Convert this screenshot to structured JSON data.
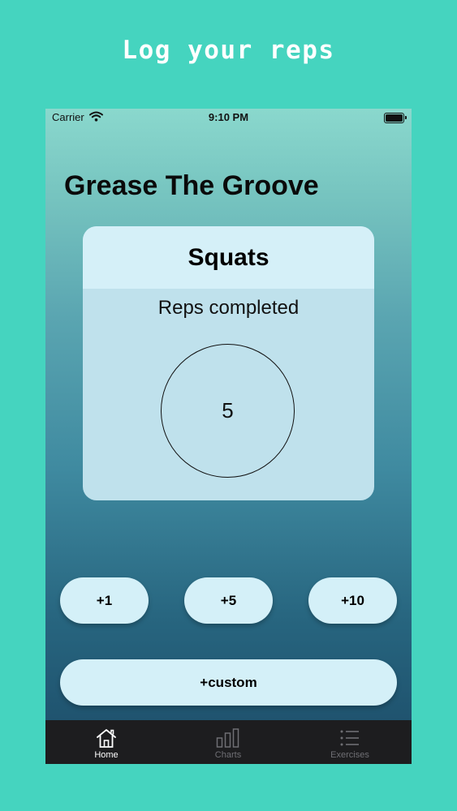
{
  "headline": "Log your reps",
  "status_bar": {
    "carrier": "Carrier",
    "time": "9:10 PM"
  },
  "app": {
    "title": "Grease The Groove"
  },
  "exercise_card": {
    "exercise_name": "Squats",
    "reps_label": "Reps completed",
    "reps_count": "5"
  },
  "buttons": {
    "plus_one": "+1",
    "plus_five": "+5",
    "plus_ten": "+10",
    "plus_custom": "+custom"
  },
  "tab_bar": {
    "items": [
      {
        "label": "Home",
        "icon": "home-icon",
        "active": true
      },
      {
        "label": "Charts",
        "icon": "bar-chart-icon",
        "active": false
      },
      {
        "label": "Exercises",
        "icon": "list-icon",
        "active": false
      }
    ]
  },
  "colors": {
    "page_background": "#45d4bf",
    "button_background": "#d4f0f8",
    "tab_bar_background": "#1d1d1f"
  }
}
